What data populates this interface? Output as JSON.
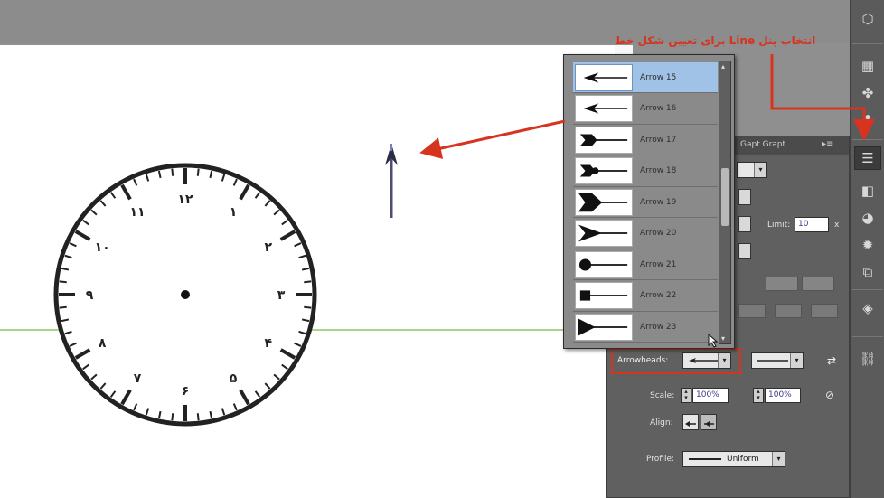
{
  "annotation": {
    "text": "انتخاب پنل Line برای تعیین شکل خط",
    "color": "#d6341e"
  },
  "clock": {
    "numerals": [
      "۱۲",
      "۱",
      "۲",
      "۳",
      "۴",
      "۵",
      "۶",
      "۷",
      "۸",
      "۹",
      "۱۰",
      "۱۱"
    ]
  },
  "dropdown": {
    "items": [
      {
        "label": "Arrow 15",
        "shape": "arrow-thin",
        "selected": true
      },
      {
        "label": "Arrow 16",
        "shape": "arrow-thin",
        "selected": false
      },
      {
        "label": "Arrow 17",
        "shape": "feather",
        "selected": false
      },
      {
        "label": "Arrow 18",
        "shape": "feather-circle",
        "selected": false
      },
      {
        "label": "Arrow 19",
        "shape": "notch-arrow",
        "selected": false
      },
      {
        "label": "Arrow 20",
        "shape": "swallow-arrow",
        "selected": false
      },
      {
        "label": "Arrow 21",
        "shape": "circle",
        "selected": false
      },
      {
        "label": "Arrow 22",
        "shape": "square",
        "selected": false
      },
      {
        "label": "Arrow 23",
        "shape": "triangle",
        "selected": false
      }
    ]
  },
  "panel": {
    "tab_label": "Gapt Grapt",
    "limit_label": "Limit:",
    "limit_value": "10",
    "limit_suffix": "x",
    "arrowheads_label": "Arrowheads:",
    "scale_label": "Scale:",
    "scale_start": "100%",
    "scale_end": "100%",
    "align_label": "Align:",
    "profile_label": "Profile:",
    "profile_value": "Uniform"
  },
  "toolbar": {
    "icons": [
      "pathfinder-icon",
      "swatches-icon",
      "symbols-icon",
      "brushes-icon",
      "stroke-icon",
      "gradient-icon",
      "transparency-icon",
      "appearance-icon",
      "graphic-styles-icon",
      "layers-icon",
      "links-icon"
    ]
  }
}
